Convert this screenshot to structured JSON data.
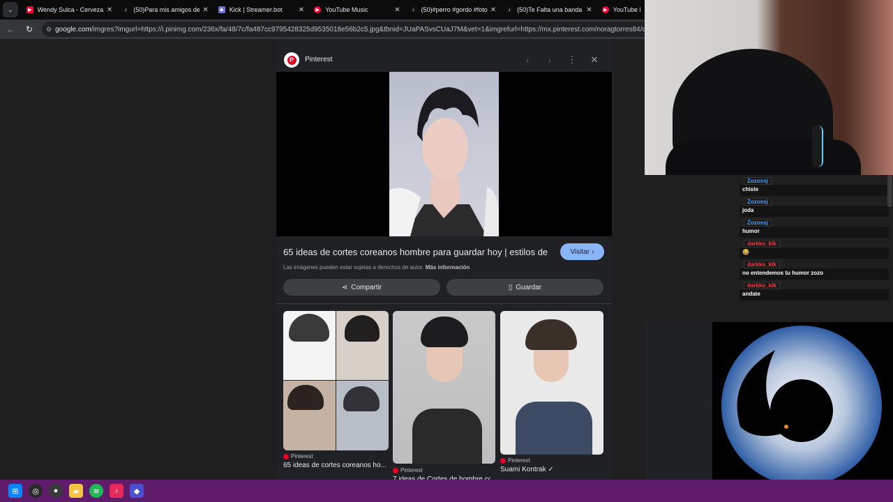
{
  "tabs": [
    {
      "title": "Wendy Sulca - Cerveza, C",
      "icon": "youtube-icon",
      "color": "#ff0033"
    },
    {
      "title": "(50)Para mis amigos del c",
      "icon": "tiktok-icon",
      "color": "#ffffff"
    },
    {
      "title": "Kick | Streamer.bot",
      "icon": "streamerbot-icon",
      "color": "#7c83fd"
    },
    {
      "title": "YouTube Music",
      "icon": "youtube-music-icon",
      "color": "#ff0033"
    },
    {
      "title": "(50)#perro #gordo #foton",
      "icon": "tiktok-icon",
      "color": "#ffffff"
    },
    {
      "title": "(50)Te Falta una banda De",
      "icon": "tiktok-icon",
      "color": "#ffffff"
    },
    {
      "title": "YouTube Mu",
      "icon": "youtube-music-icon",
      "color": "#ff0033"
    }
  ],
  "address": {
    "domain": "google.com",
    "path": "/imgres?imgurl=https://i.pinimg.com/236x/fa/48/7c/fa487cc9795428325d9535018e56b2c5.jpg&tbnid=JUaPASvsCUaJ7M&vet=1&imgrefurl=https://mx.pinterest.com/noragtorres84/cortes-core"
  },
  "panel": {
    "source": "Pinterest",
    "title": "65 ideas de cortes coreanos hombre para guardar hoy | estilos de ...",
    "visit_label": "Visitar",
    "copyright_text": "Las imágenes pueden estar sujetas a derechos de autor.",
    "more_info": "Más información",
    "share_label": "Compartir",
    "save_label": "Guardar"
  },
  "related": [
    {
      "source": "Pinterest",
      "title": "65 ideas de cortes coreanos ho..."
    },
    {
      "source": "Pinterest",
      "title": "7 ideas de Cortes de hombre co..."
    },
    {
      "source": "Pinterest",
      "title": "Suami Kontrak ✓"
    }
  ],
  "chat": [
    {
      "user": "Zozossj",
      "text": "chiste",
      "color": "#4a9cff"
    },
    {
      "user": "Zozossj",
      "text": "joda",
      "color": "#4a9cff"
    },
    {
      "user": "Zozossj",
      "text": "humor",
      "color": "#4a9cff"
    },
    {
      "user": "darkko_klk",
      "text": "😂",
      "color": "#ff3344"
    },
    {
      "user": "darkko_klk",
      "text": "no entendemos tu humor zozo",
      "color": "#ff3344"
    },
    {
      "user": "darkko_klk",
      "text": "andate",
      "color": "#ff3344"
    }
  ],
  "taskbar": [
    "windows-start-icon",
    "obs-icon",
    "chrome-icon",
    "file-explorer-icon",
    "spotify-icon",
    "tiktok-icon",
    "streamerbot-icon"
  ]
}
